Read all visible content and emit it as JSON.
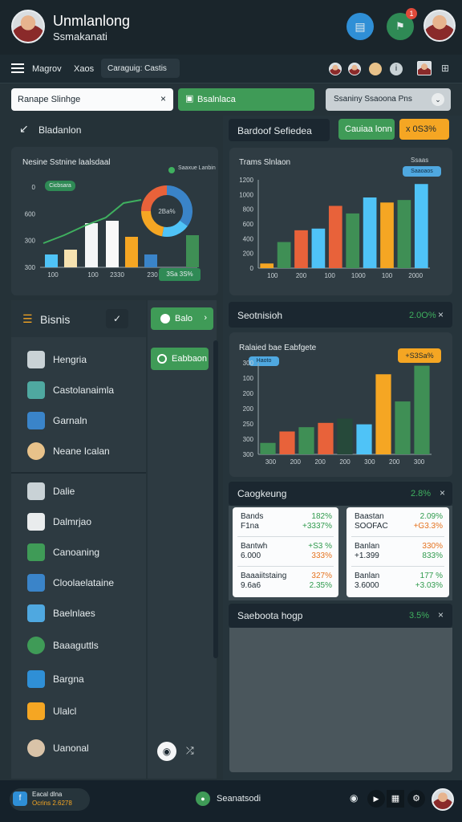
{
  "header": {
    "title": "Unmlanlong",
    "subtitle": "Ssmakanati",
    "notification_badge": "1"
  },
  "nav": {
    "items": [
      "Magrov",
      "Xaos",
      "Caraguig: Castis"
    ]
  },
  "search": {
    "value": "Ranape Slinhge",
    "select_value": "Ssaniny Ssaoona Pns",
    "action_label": "Bsalnlaca"
  },
  "sidebar": {
    "back_label": "Bladanlon",
    "section_title": "Bisnis",
    "items": [
      "Hengria",
      "Castolanaimla",
      "Garnaln",
      "Neane Icalan",
      "Dalie",
      "Dalmrjao",
      "Canoaning",
      "Cloolaelataine",
      "Baelnlaes",
      "Baaaguttls",
      "Bargna",
      "Ulalcl",
      "Uanonal"
    ]
  },
  "mid": {
    "pill1": "Balo",
    "pill2": "Eabbaon"
  },
  "chart1": {
    "title": "Nesine Sstnine laalsdaal",
    "legend_top": "Saaxue Lanbin",
    "legend_pill": "Cicbsara",
    "donut_label": "2Ba%",
    "badge": "3Sa 3S%"
  },
  "right": {
    "header_title": "Bardoof Sefiedea",
    "btn_green": "Cauiaa lonn",
    "btn_yellow": "x 0S3%",
    "section2_title": "Seotnisioh",
    "section2_value": "2.0O%",
    "section3_title": "Caogkeung",
    "section3_value": "2.8%",
    "section4_title": "Saeboota hogp",
    "section4_value": "3.5%"
  },
  "chart2": {
    "title": "Trams Slnlaon",
    "legend_top": "Ssaas",
    "legend_pill": "Saaoaos"
  },
  "chart3": {
    "title": "Ralaied bae Eabfgete",
    "legend_pill": "Haoto",
    "badge": "+S3Sa%"
  },
  "cards": [
    {
      "rows": [
        [
          "Bands",
          "182%",
          "F1na",
          "+3337%"
        ],
        [
          "Bantwh",
          "+S3 %",
          "6.000",
          "333%"
        ],
        [
          "Baaaiitstaing",
          "327%",
          "9.6a6",
          "2.35%"
        ]
      ]
    },
    {
      "rows": [
        [
          "Baastan",
          "2.09%",
          "SOOFAC",
          "+G3.3%"
        ],
        [
          "Banlan",
          "330%",
          "+1.399",
          "833%"
        ],
        [
          "Banlan",
          "177 %",
          "3.6000",
          "+3.03%"
        ]
      ]
    }
  ],
  "bottom": {
    "badge_line1": "Eacal dlna",
    "badge_line2": "Ocrins 2.6278",
    "center_label": "Seanatsodi"
  },
  "chart_data": [
    {
      "type": "bar",
      "title": "Nesine Sstnine laalsdaal",
      "y_ticks": [
        "0",
        "600",
        "300",
        "300"
      ],
      "x_ticks": [
        "100",
        "100",
        "2330",
        "230"
      ],
      "values": [
        16,
        22,
        55,
        58,
        38,
        16,
        40
      ],
      "line": [
        30,
        40,
        52,
        62,
        80,
        84
      ],
      "colors": [
        "#4fc3f7",
        "#f6e2b0",
        "#f4f6f7",
        "#f8f8f8",
        "#f5a623",
        "#3a84c9",
        "#3f8f55"
      ]
    },
    {
      "type": "bar",
      "title": "Trams Slnlaon",
      "y_ticks": [
        "1200",
        "1000",
        "800",
        "600",
        "400",
        "200",
        "0"
      ],
      "x_ticks": [
        "100",
        "200",
        "100",
        "1000",
        "100",
        "2000"
      ],
      "values": [
        55,
        310,
        450,
        470,
        740,
        650,
        840,
        780,
        810,
        1000
      ],
      "colors": [
        "#f5a623",
        "#3f8f55",
        "#e8623a",
        "#4fc3f7",
        "#e8623a",
        "#3f8f55",
        "#4fc3f7",
        "#f5a623",
        "#3f8f55",
        "#4fc3f7"
      ]
    },
    {
      "type": "bar",
      "title": "Ralaied bae Eabfgete",
      "y_ticks": [
        "300",
        "100",
        "200",
        "200",
        "250",
        "300",
        "300"
      ],
      "x_ticks": [
        "300",
        "200",
        "200",
        "200",
        "300",
        "200",
        "300"
      ],
      "values": [
        40,
        80,
        95,
        110,
        125,
        105,
        280,
        185,
        310
      ],
      "colors": [
        "#3f8f55",
        "#e8623a",
        "#3f8f55",
        "#e8623a",
        "#26493a",
        "#4fc3f7",
        "#f5a623",
        "#3f8f55",
        "#3f8f55"
      ]
    }
  ]
}
